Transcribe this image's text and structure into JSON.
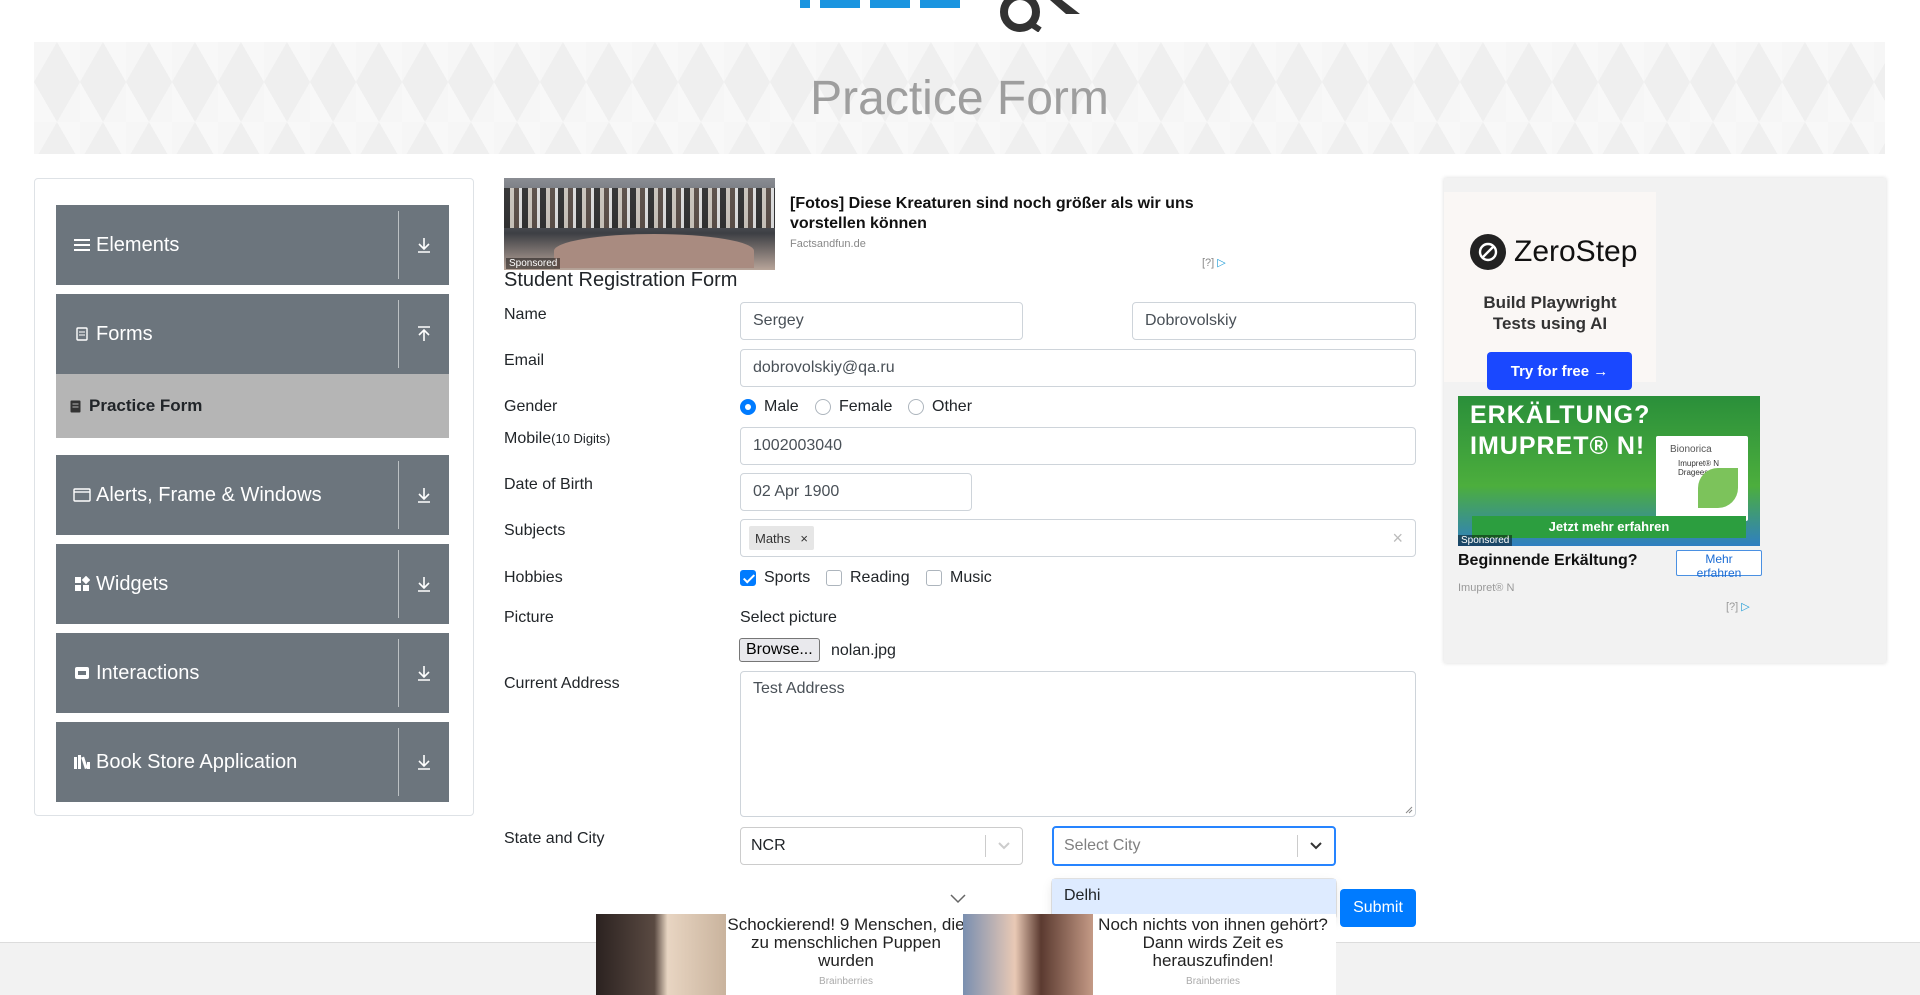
{
  "banner": {
    "title": "Practice Form"
  },
  "sidebar": {
    "groups": [
      {
        "label": "Elements",
        "icon": "hamburger-icon",
        "arrow": "down-arrow-icon"
      },
      {
        "label": "Forms",
        "icon": "document-icon",
        "arrow": "up-arrow-icon"
      },
      {
        "label": "Alerts, Frame & Windows",
        "icon": "window-icon",
        "arrow": "down-arrow-icon"
      },
      {
        "label": "Widgets",
        "icon": "widgets-icon",
        "arrow": "down-arrow-icon"
      },
      {
        "label": "Interactions",
        "icon": "interactions-icon",
        "arrow": "down-arrow-icon"
      },
      {
        "label": "Book Store Application",
        "icon": "books-icon",
        "arrow": "down-arrow-icon"
      }
    ],
    "active_item": "Practice Form"
  },
  "ad_top": {
    "title": "[Fotos] Diese Kreaturen sind noch größer als wir uns vorstellen können",
    "source": "Factsandfun.de",
    "sponsored": "Sponsored",
    "info": "[?]"
  },
  "form": {
    "title": "Student Registration Form",
    "name_label": "Name",
    "first_name": "Sergey",
    "last_name": "Dobrovolskiy",
    "email_label": "Email",
    "email": "dobrovolskiy@qa.ru",
    "gender_label": "Gender",
    "gender_options": [
      "Male",
      "Female",
      "Other"
    ],
    "gender_selected": "Male",
    "mobile_label": "Mobile",
    "mobile_hint": "(10 Digits)",
    "mobile": "1002003040",
    "dob_label": "Date of Birth",
    "dob": "02 Apr 1900",
    "subjects_label": "Subjects",
    "subjects": [
      "Maths"
    ],
    "subject_remove": "×",
    "subjects_clear": "×",
    "hobbies_label": "Hobbies",
    "hobbies": [
      "Sports",
      "Reading",
      "Music"
    ],
    "hobbies_checked": [
      "Sports"
    ],
    "picture_label": "Picture",
    "select_picture": "Select picture",
    "browse_label": "Browse...",
    "file_name": "nolan.jpg",
    "address_label": "Current Address",
    "address": "Test Address",
    "state_city_label": "State and City",
    "state": "NCR",
    "city_placeholder": "Select City",
    "city_options": [
      "Delhi"
    ],
    "submit_label": "Submit"
  },
  "ad_right": {
    "brand": "ZeroStep",
    "tagline": "Build Playwright Tests using AI",
    "cta": "Try for free →",
    "headline_image_text": "ERKÄLTUNG? IMUPRET® N!",
    "box_brand": "Bionorica",
    "box_product": "Imupret® N Dragees",
    "image_bar": "Jetzt mehr erfahren",
    "sponsored": "Sponsored",
    "title": "Beginnende Erkältung?",
    "button": "Mehr erfahren",
    "source": "Imupret® N",
    "info": "[?]"
  },
  "bottom_ads": [
    {
      "title": "Schockierend! 9 Menschen, die zu menschlichen Puppen wurden",
      "source": "Brainberries"
    },
    {
      "title": "Noch nichts von ihnen gehört? Dann wirds Zeit es herauszufinden!",
      "source": "Brainberries"
    }
  ],
  "colors": {
    "sidebar_group": "#6c757d",
    "sidebar_active": "#b5b5b5",
    "primary": "#007bff",
    "focus": "#2684ff",
    "option_hover": "#deebff"
  }
}
